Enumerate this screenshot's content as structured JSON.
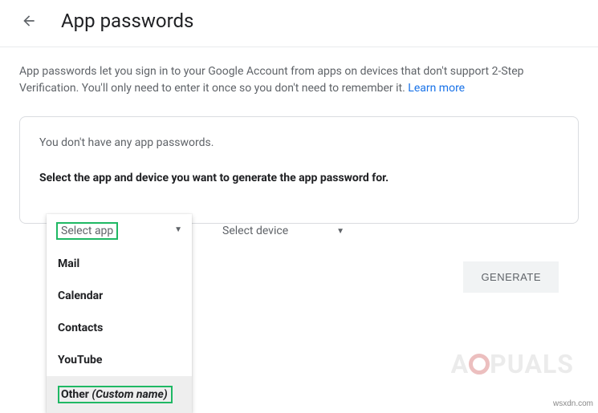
{
  "header": {
    "title": "App passwords"
  },
  "description": {
    "text": "App passwords let you sign in to your Google Account from apps on devices that don't support 2-Step Verification. You'll only need to enter it once so you don't need to remember it. ",
    "learn_more": "Learn more"
  },
  "card": {
    "status": "You don't have any app passwords.",
    "instruction": "Select the app and device you want to generate the app password for.",
    "select_app_label": "Select app",
    "select_device_label": "Select device",
    "generate_label": "GENERATE"
  },
  "dropdown": {
    "header": "Select app",
    "items": [
      {
        "label": "Mail"
      },
      {
        "label": "Calendar"
      },
      {
        "label": "Contacts"
      },
      {
        "label": "YouTube"
      }
    ],
    "other_label": "Other",
    "other_hint": "(Custom name)"
  },
  "watermark": {
    "prefix": "A",
    "suffix": "PUALS"
  },
  "source": "wsxdn.com"
}
